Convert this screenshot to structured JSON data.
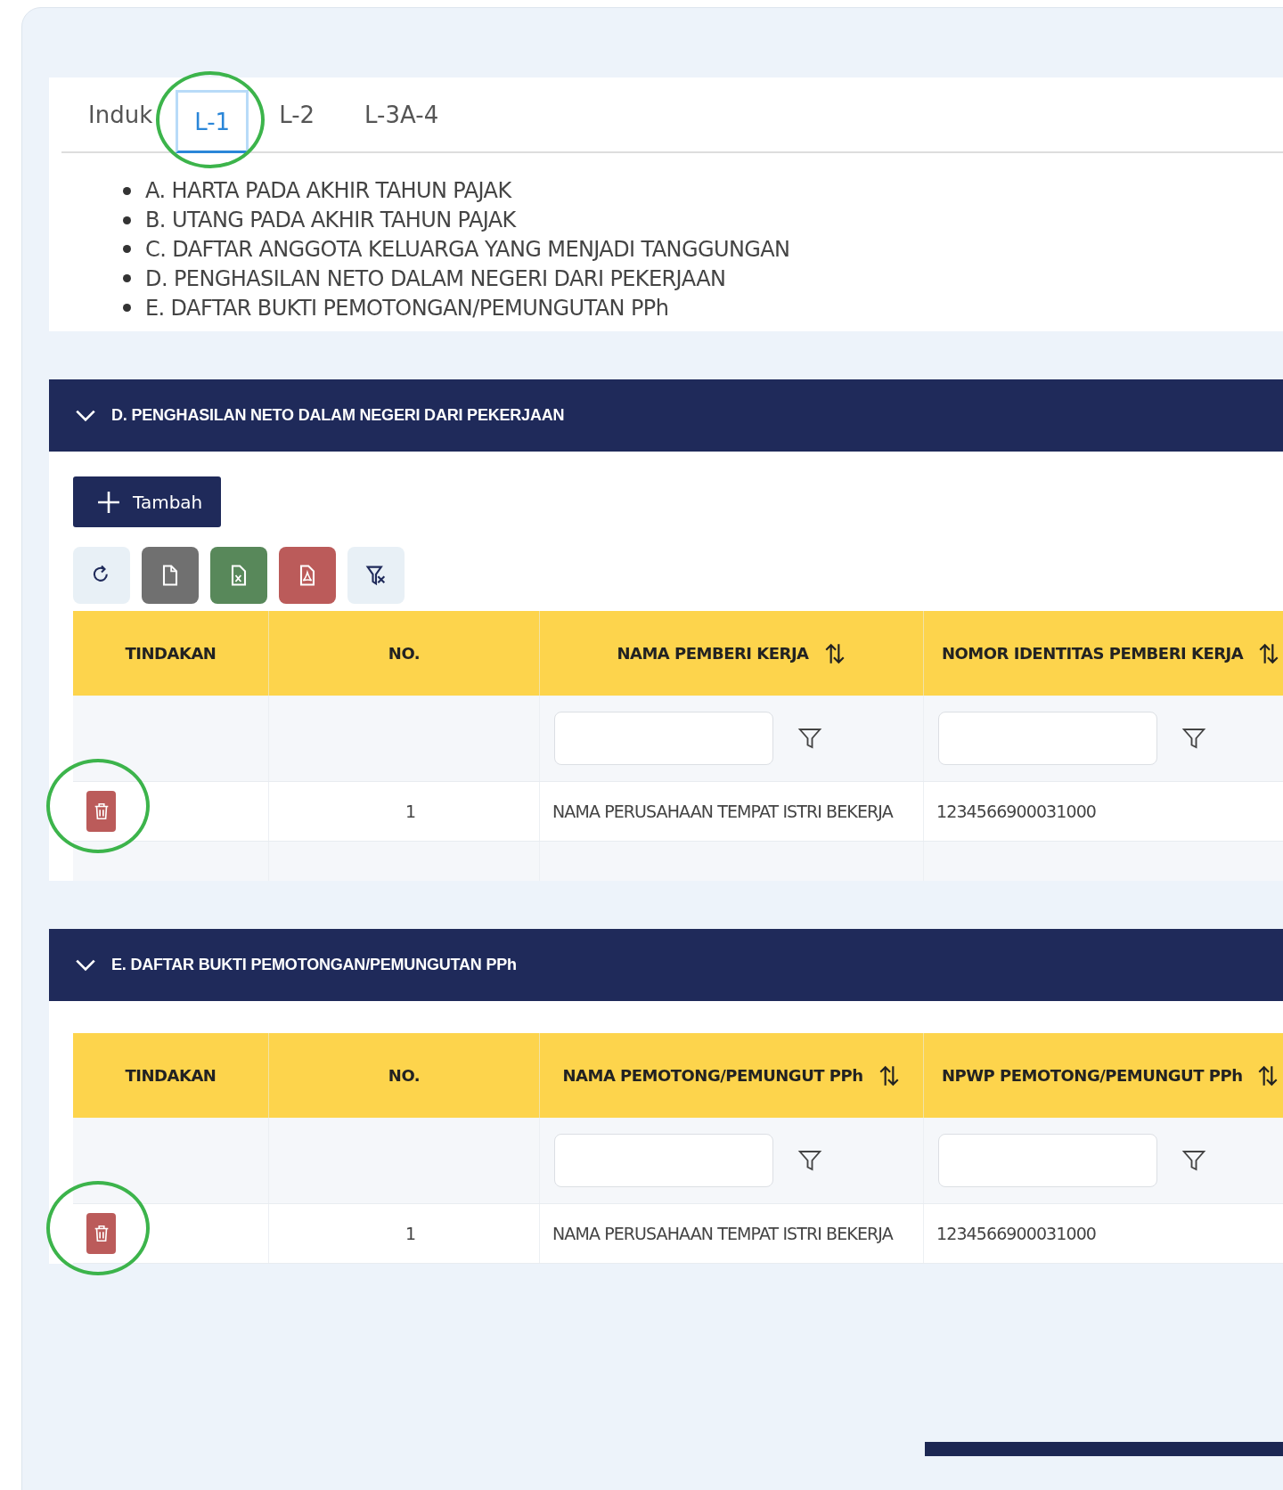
{
  "tabs": [
    {
      "label": "Induk",
      "selected": false,
      "highlighted": false
    },
    {
      "label": "L-1",
      "selected": true,
      "highlighted": true
    },
    {
      "label": "L-2",
      "selected": false,
      "highlighted": false
    },
    {
      "label": "L-3A-4",
      "selected": false,
      "highlighted": false
    }
  ],
  "summary_list": [
    "A. HARTA PADA AKHIR TAHUN PAJAK",
    "B. UTANG PADA AKHIR TAHUN PAJAK",
    "C. DAFTAR ANGGOTA KELUARGA YANG MENJADI TANGGUNGAN",
    "D. PENGHASILAN NETO DALAM NEGERI DARI PEKERJAAN",
    "E. DAFTAR BUKTI PEMOTONGAN/PEMUNGUTAN PPh"
  ],
  "sections": [
    {
      "title": "D. PENGHASILAN NETO DALAM NEGERI DARI PEKERJAAN",
      "expanded": true,
      "add_button": "Tambah",
      "toolbar": [
        {
          "kind": "refresh"
        },
        {
          "kind": "file"
        },
        {
          "kind": "excel"
        },
        {
          "kind": "pdf"
        },
        {
          "kind": "clear-filter"
        }
      ],
      "table": {
        "columns": [
          {
            "label": "TINDAKAN",
            "sortable": false,
            "filterable": false
          },
          {
            "label": "NO.",
            "sortable": false,
            "filterable": false
          },
          {
            "label": "NAMA PEMBERI KERJA",
            "sortable": true,
            "filterable": true
          },
          {
            "label": "NOMOR IDENTITAS PEMBERI KERJA",
            "sortable": true,
            "filterable": true
          }
        ],
        "rows": [
          {
            "deletable": true,
            "cells": [
              "",
              "1",
              "NAMA PERUSAHAAN TEMPAT ISTRI BEKERJA",
              "1234566900031000"
            ],
            "highlighted": true
          }
        ],
        "trailing_row": true
      }
    },
    {
      "title": "E. DAFTAR BUKTI PEMOTONGAN/PEMUNGUTAN PPh",
      "expanded": true,
      "table": {
        "columns": [
          {
            "label": "TINDAKAN",
            "sortable": false,
            "filterable": false
          },
          {
            "label": "NO.",
            "sortable": false,
            "filterable": false
          },
          {
            "label": "NAMA PEMOTONG/PEMUNGUT PPh",
            "sortable": true,
            "filterable": true
          },
          {
            "label": "NPWP PEMOTONG/PEMUNGUT PPh",
            "sortable": true,
            "filterable": true
          }
        ],
        "rows": [
          {
            "deletable": true,
            "cells": [
              "",
              "1",
              "NAMA PERUSAHAAN TEMPAT ISTRI BEKERJA",
              "1234566900031000"
            ],
            "highlighted": true
          }
        ]
      }
    }
  ]
}
